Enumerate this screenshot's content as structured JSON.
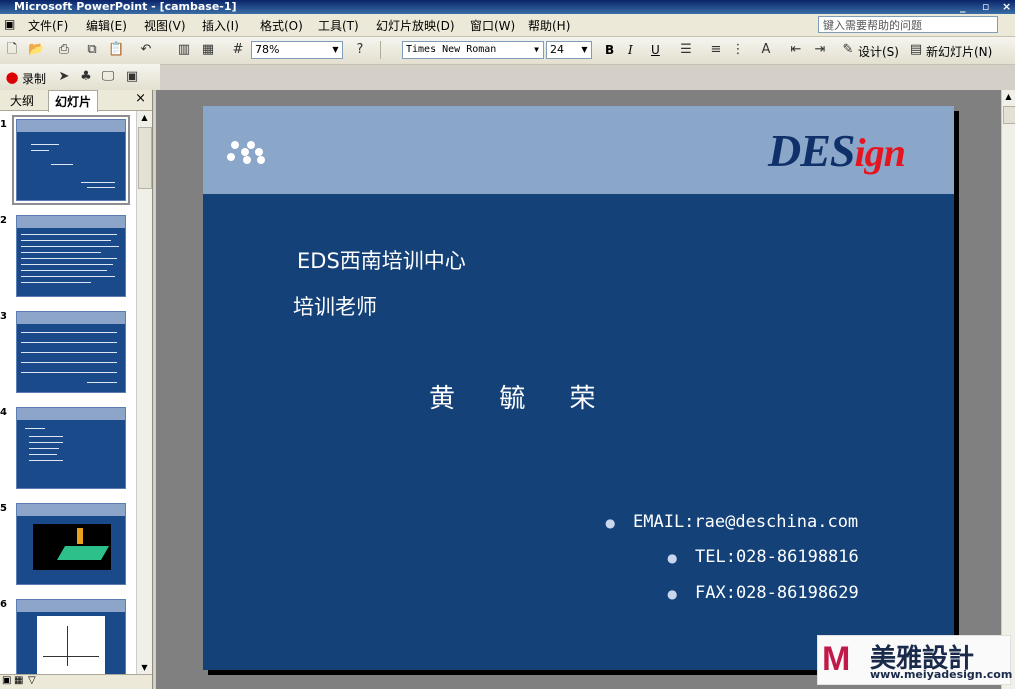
{
  "window": {
    "title": "Microsoft PowerPoint - [cambase-1]"
  },
  "menu": {
    "items": [
      "文件(F)",
      "编辑(E)",
      "视图(V)",
      "插入(I)",
      "格式(O)",
      "工具(T)",
      "幻灯片放映(D)",
      "窗口(W)",
      "帮助(H)"
    ],
    "help_placeholder": "键入需要帮助的问题"
  },
  "toolbar": {
    "zoom": "78%",
    "font": "Times New Roman",
    "font_size": "24",
    "bold": "B",
    "italic": "I",
    "underline": "U",
    "design_label": "设计(S)",
    "new_slide_label": "新幻灯片(N)",
    "record_label": "录制"
  },
  "pane": {
    "tab_outline": "大纲",
    "tab_slides": "幻灯片",
    "thumbnail_numbers": [
      "1",
      "2",
      "3",
      "4",
      "5",
      "6"
    ]
  },
  "slide": {
    "logo_main": "DES",
    "logo_accent": "ign",
    "line1": "EDS西南培训中心",
    "line2": "培训老师",
    "name": "黄 毓 荣",
    "email": "EMAIL:rae@deschina.com",
    "tel": "TEL:028-86198816",
    "fax": "FAX:028-86198629"
  },
  "watermark": {
    "brand": "美雅設計",
    "url": "www.meiyadesign.com"
  },
  "colors": {
    "slide_bg": "#134178",
    "slide_header": "#8aa6c8",
    "logo_accent": "#e6141e"
  }
}
